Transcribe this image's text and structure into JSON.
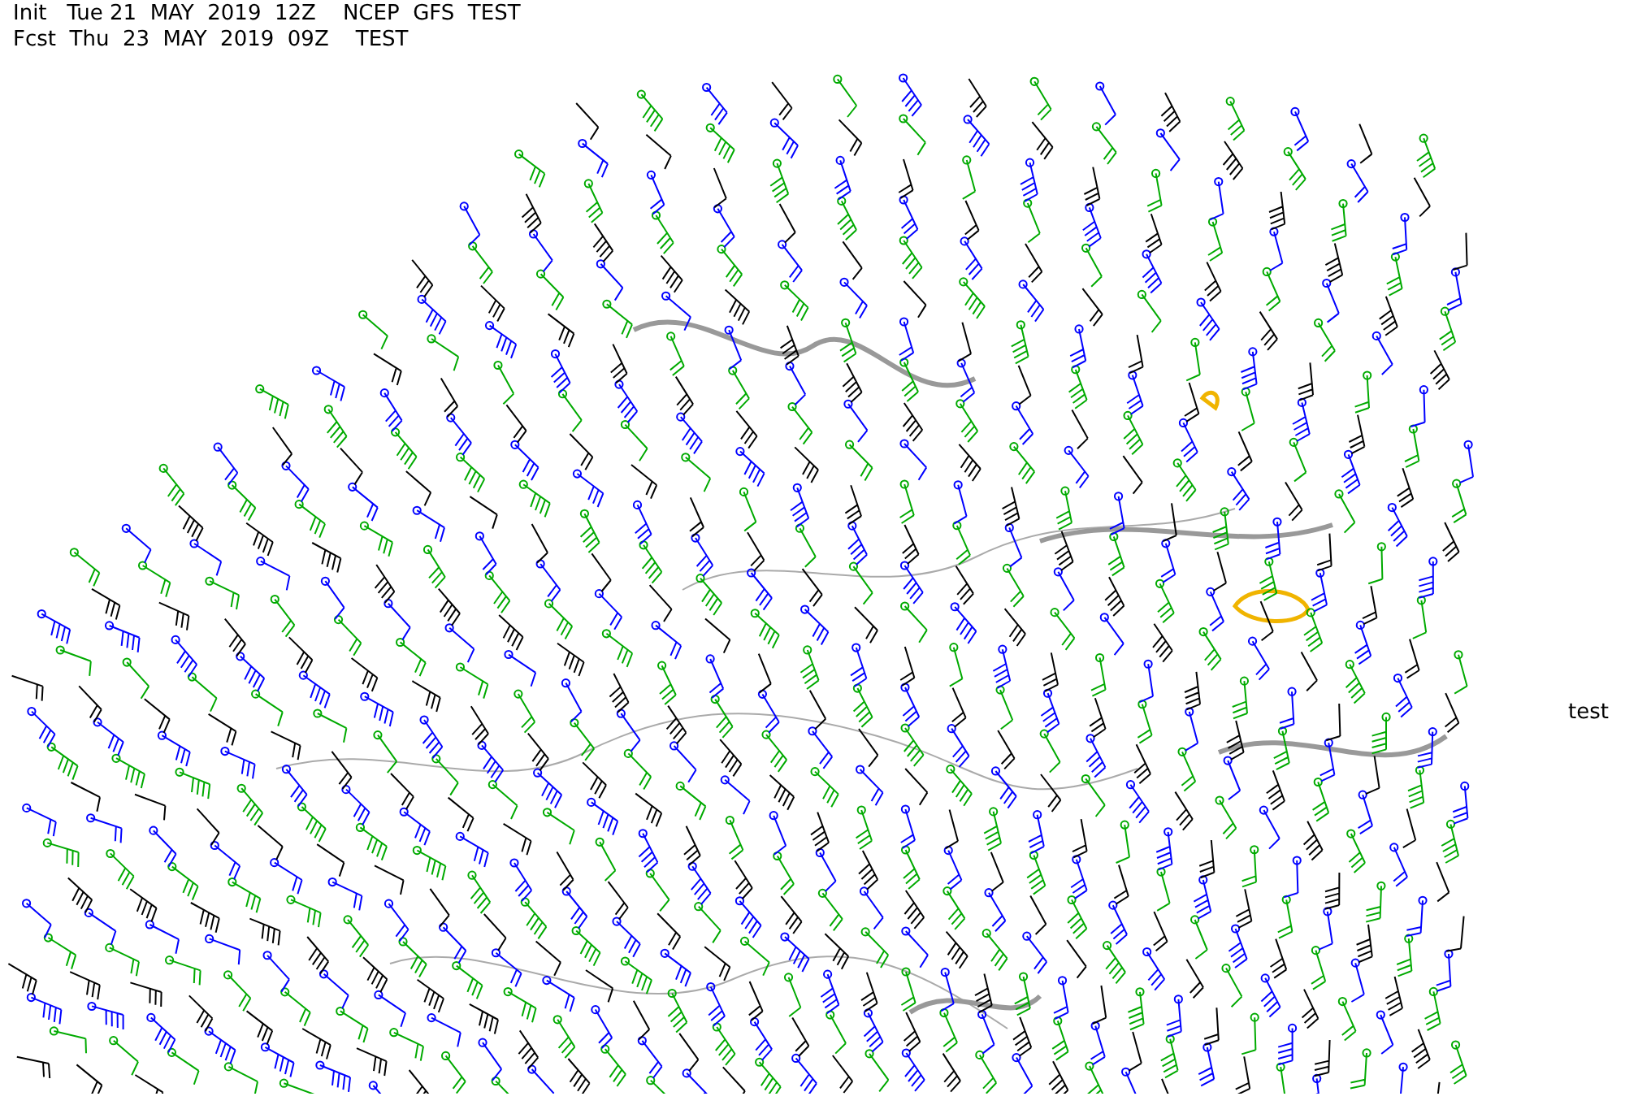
{
  "header": {
    "lines": [
      "Init   Tue 21  MAY  2019  12Z    NCEP  GFS  TEST",
      "Fcst  Thu  23  MAY  2019  09Z    TEST"
    ]
  },
  "side_label": "test"
}
